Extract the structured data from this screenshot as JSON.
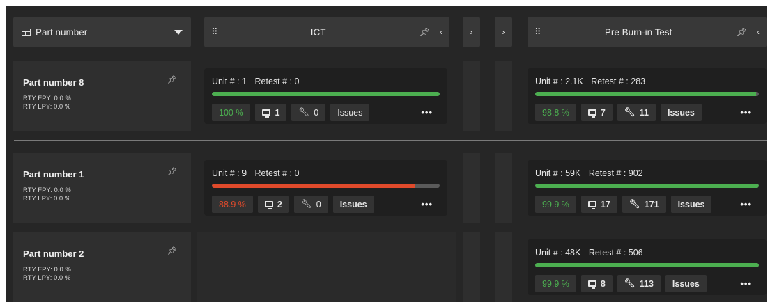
{
  "header": {
    "part_column": {
      "label": "Part number",
      "icon": "table-icon"
    },
    "stations": [
      {
        "title": "ICT",
        "icons": [
          "drag-handle-icon",
          "pin-icon",
          "chevron-left-icon"
        ]
      },
      {
        "title": "Pre Burn-in Test",
        "icons": [
          "drag-handle-icon",
          "pin-icon",
          "chevron-left-icon"
        ]
      }
    ],
    "collapsed_expanders": [
      "chevron-right-icon",
      "chevron-right-icon"
    ]
  },
  "rows": [
    {
      "part": {
        "name": "Part number 8",
        "rty_fpy": "RTY FPY: 0.0 %",
        "rty_lpy": "RTY LPY: 0.0 %",
        "pinned": true
      },
      "ict": {
        "unit": "Unit # : 1",
        "retest": "Retest # : 0",
        "fill": 1.0,
        "fill_color": "#4caf50",
        "pct": "100 %",
        "pct_status": "good",
        "stations": "1",
        "repairs": "0",
        "issues": "Issues",
        "more": "•••"
      },
      "pbt": {
        "unit": "Unit # : 2.1K",
        "retest": "Retest # : 283",
        "fill": 0.988,
        "fill_color": "#4caf50",
        "pct": "98.8 %",
        "pct_status": "good",
        "stations": "7",
        "repairs": "11",
        "issues": "Issues",
        "more": "•••"
      }
    },
    {
      "part": {
        "name": "Part number 1",
        "rty_fpy": "RTY FPY: 0.0 %",
        "rty_lpy": "RTY LPY: 0.0 %",
        "pinned": false
      },
      "ict": {
        "unit": "Unit # : 9",
        "retest": "Retest # : 0",
        "fill": 0.889,
        "fill_color": "#e04a2b",
        "pct": "88.9 %",
        "pct_status": "bad",
        "stations": "2",
        "repairs": "0",
        "issues": "Issues",
        "more": "•••"
      },
      "pbt": {
        "unit": "Unit # : 59K",
        "retest": "Retest # : 902",
        "fill": 0.999,
        "fill_color": "#4caf50",
        "pct": "99.9 %",
        "pct_status": "good",
        "stations": "17",
        "repairs": "171",
        "issues": "Issues",
        "more": "•••"
      }
    },
    {
      "part": {
        "name": "Part number 2",
        "rty_fpy": "RTY FPY: 0.0 %",
        "rty_lpy": "RTY LPY: 0.0 %",
        "pinned": false
      },
      "ict": null,
      "pbt": {
        "unit": "Unit # : 48K",
        "retest": "Retest # : 506",
        "fill": 0.999,
        "fill_color": "#4caf50",
        "pct": "99.9 %",
        "pct_status": "good",
        "stations": "8",
        "repairs": "113",
        "issues": "Issues",
        "more": "•••"
      }
    }
  ],
  "colors": {
    "background": "#262626",
    "good": "#4caf50",
    "bad": "#e04a2b",
    "bar_track": "#5a5a5a"
  }
}
